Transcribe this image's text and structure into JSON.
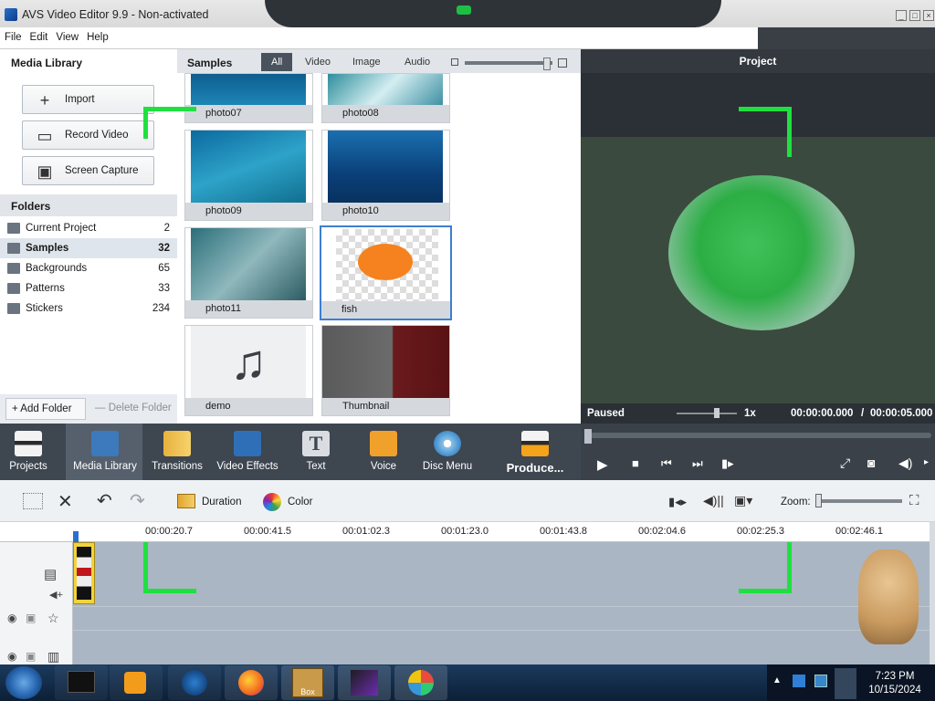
{
  "window": {
    "title": "AVS Video Editor 9.9 - Non-activated"
  },
  "menu": [
    "File",
    "Edit",
    "View",
    "Help"
  ],
  "media_library": {
    "header": "Media Library",
    "import_label": "Import",
    "record_label": "Record Video",
    "screen_label": "Screen Capture"
  },
  "folders": {
    "header": "Folders",
    "items": [
      {
        "name": "Current Project",
        "count": "2"
      },
      {
        "name": "Samples",
        "count": "32"
      },
      {
        "name": "Backgrounds",
        "count": "65"
      },
      {
        "name": "Patterns",
        "count": "33"
      },
      {
        "name": "Stickers",
        "count": "234"
      }
    ],
    "add_label": "+ Add Folder",
    "delete_label": "— Delete Folder"
  },
  "samples": {
    "header": "Samples",
    "tabs": [
      "All",
      "Video",
      "Image",
      "Audio"
    ],
    "tiles": [
      "photo07",
      "photo08",
      "photo09",
      "photo10",
      "photo11",
      "fish",
      "demo",
      "Thumbnail"
    ]
  },
  "preview": {
    "header": "Project",
    "status": "Paused",
    "speed": "1x",
    "time_current": "00:00:00.000",
    "time_sep": "/",
    "time_total": "00:00:05.000"
  },
  "toolbar": {
    "items": [
      "Projects",
      "Media Library",
      "Transitions",
      "Video Effects",
      "Text",
      "Voice",
      "Disc Menu",
      "Produce..."
    ]
  },
  "timeline": {
    "duration_label": "Duration",
    "color_label": "Color",
    "zoom_label": "Zoom:",
    "ticks": [
      "00:00:20.7",
      "00:00:41.5",
      "00:01:02.3",
      "00:01:23.0",
      "00:01:43.8",
      "00:02:04.6",
      "00:02:25.3",
      "00:02:46.1"
    ]
  },
  "taskbar": {
    "time": "7:23 PM",
    "date": "10/15/2024",
    "box_label": "Box"
  }
}
